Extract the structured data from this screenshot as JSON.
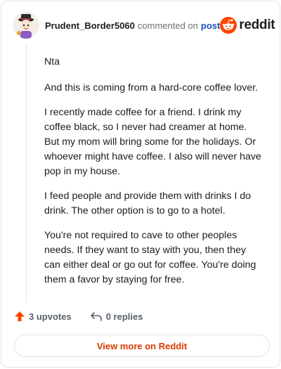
{
  "comment": {
    "username": "Prudent_Border5060",
    "action_text": "commented on",
    "post_link": "post",
    "brand": "reddit",
    "paragraphs": [
      "Nta",
      "And this is coming from a hard-core coffee lover.",
      "I recently made coffee for a friend. I drink my coffee black, so I never had creamer at home. But my mom will bring some for the holidays. Or whoever might have coffee. I also will never have pop in my house.",
      "I feed people and provide them with drinks I do drink. The other option is to go to a hotel.",
      "You're not required to cave to other peoples needs. If they want to stay with you, then they can either deal or go out for coffee. You're doing them a favor by staying for free."
    ]
  },
  "actions": {
    "upvotes": "3 upvotes",
    "replies": "0 replies"
  },
  "view_more": "View more on Reddit",
  "colors": {
    "reddit_orange": "#ff4500",
    "link_blue": "#1a4fb8",
    "view_more_text": "#d93900"
  },
  "icons": [
    "avatar",
    "reddit-logo-icon",
    "upvote-icon",
    "reply-icon"
  ]
}
